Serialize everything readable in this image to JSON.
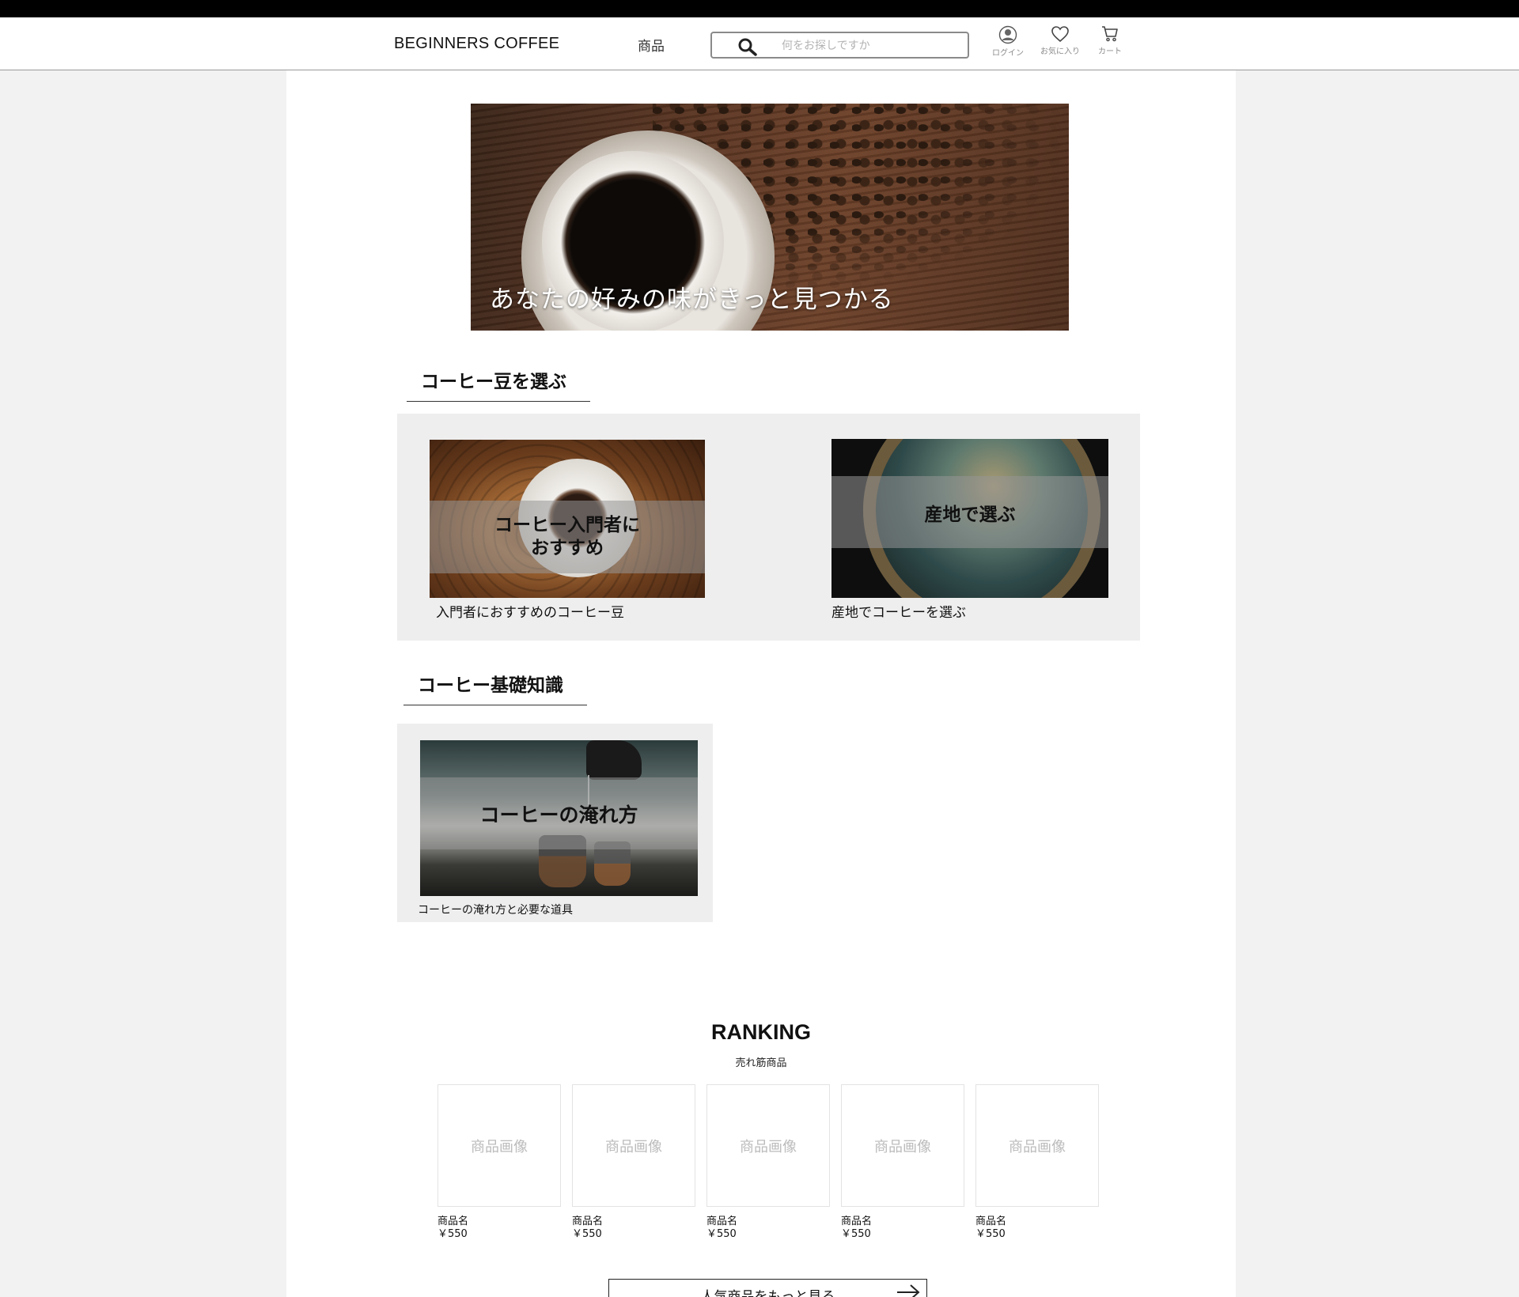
{
  "header": {
    "brand": "BEGINNERS COFFEE",
    "nav_products": "商品",
    "search_placeholder": "何をお探しですか",
    "login_label": "ログイン",
    "favorites_label": "お気に入り",
    "cart_label": "カート"
  },
  "hero": {
    "caption": "あなたの好みの味がきっと見つかる"
  },
  "beans_section": {
    "title": "コーヒー豆を選ぶ",
    "cards": [
      {
        "overlay_line1": "コーヒー入門者に",
        "overlay_line2": "おすすめ",
        "caption": "入門者におすすめのコーヒー豆"
      },
      {
        "overlay": "産地で選ぶ",
        "caption": "産地でコーヒーを選ぶ"
      }
    ]
  },
  "basics_section": {
    "title": "コーヒー基礎知識",
    "cards": [
      {
        "overlay": "コーヒーの淹れ方",
        "caption": "コーヒーの淹れ方と必要な道具"
      }
    ]
  },
  "ranking": {
    "title": "RANKING",
    "subtitle": "売れ筋商品",
    "products": [
      {
        "image_placeholder": "商品画像",
        "name": "商品名",
        "price": "￥550"
      },
      {
        "image_placeholder": "商品画像",
        "name": "商品名",
        "price": "￥550"
      },
      {
        "image_placeholder": "商品画像",
        "name": "商品名",
        "price": "￥550"
      },
      {
        "image_placeholder": "商品画像",
        "name": "商品名",
        "price": "￥550"
      },
      {
        "image_placeholder": "商品画像",
        "name": "商品名",
        "price": "￥550"
      }
    ],
    "more_button": "人気商品をもっと見る"
  },
  "icons": {
    "search": "search-icon",
    "login": "user-icon",
    "favorites": "heart-icon",
    "cart": "cart-icon",
    "more": "arrow-right-icon"
  },
  "colors": {
    "page_background": "#f2f2f2",
    "content_background": "#ffffff",
    "panel_background": "#eeeeee",
    "top_bar": "#000000"
  }
}
